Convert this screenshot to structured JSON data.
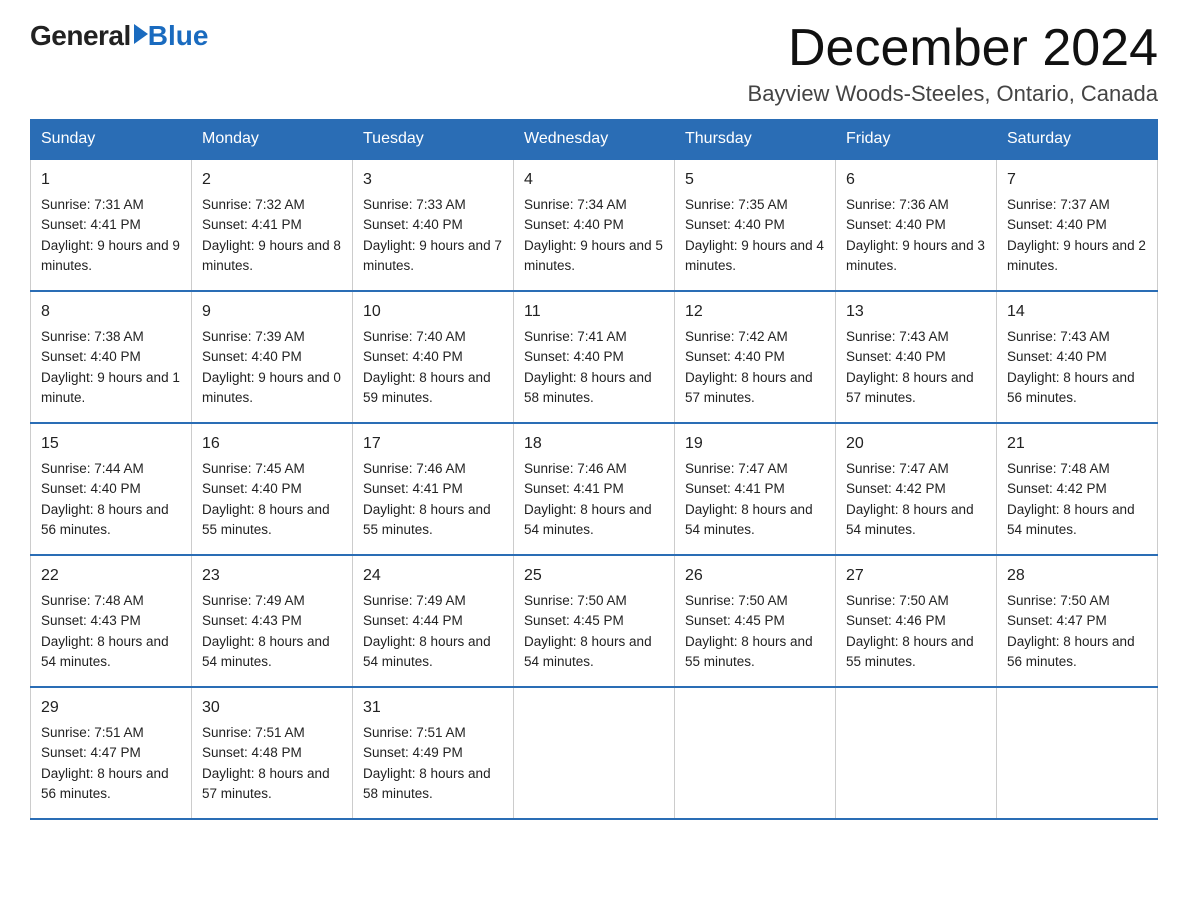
{
  "logo": {
    "general": "General",
    "blue": "Blue"
  },
  "header": {
    "month_year": "December 2024",
    "location": "Bayview Woods-Steeles, Ontario, Canada"
  },
  "days_of_week": [
    "Sunday",
    "Monday",
    "Tuesday",
    "Wednesday",
    "Thursday",
    "Friday",
    "Saturday"
  ],
  "weeks": [
    [
      {
        "day": "1",
        "sunrise": "7:31 AM",
        "sunset": "4:41 PM",
        "daylight": "9 hours and 9 minutes."
      },
      {
        "day": "2",
        "sunrise": "7:32 AM",
        "sunset": "4:41 PM",
        "daylight": "9 hours and 8 minutes."
      },
      {
        "day": "3",
        "sunrise": "7:33 AM",
        "sunset": "4:40 PM",
        "daylight": "9 hours and 7 minutes."
      },
      {
        "day": "4",
        "sunrise": "7:34 AM",
        "sunset": "4:40 PM",
        "daylight": "9 hours and 5 minutes."
      },
      {
        "day": "5",
        "sunrise": "7:35 AM",
        "sunset": "4:40 PM",
        "daylight": "9 hours and 4 minutes."
      },
      {
        "day": "6",
        "sunrise": "7:36 AM",
        "sunset": "4:40 PM",
        "daylight": "9 hours and 3 minutes."
      },
      {
        "day": "7",
        "sunrise": "7:37 AM",
        "sunset": "4:40 PM",
        "daylight": "9 hours and 2 minutes."
      }
    ],
    [
      {
        "day": "8",
        "sunrise": "7:38 AM",
        "sunset": "4:40 PM",
        "daylight": "9 hours and 1 minute."
      },
      {
        "day": "9",
        "sunrise": "7:39 AM",
        "sunset": "4:40 PM",
        "daylight": "9 hours and 0 minutes."
      },
      {
        "day": "10",
        "sunrise": "7:40 AM",
        "sunset": "4:40 PM",
        "daylight": "8 hours and 59 minutes."
      },
      {
        "day": "11",
        "sunrise": "7:41 AM",
        "sunset": "4:40 PM",
        "daylight": "8 hours and 58 minutes."
      },
      {
        "day": "12",
        "sunrise": "7:42 AM",
        "sunset": "4:40 PM",
        "daylight": "8 hours and 57 minutes."
      },
      {
        "day": "13",
        "sunrise": "7:43 AM",
        "sunset": "4:40 PM",
        "daylight": "8 hours and 57 minutes."
      },
      {
        "day": "14",
        "sunrise": "7:43 AM",
        "sunset": "4:40 PM",
        "daylight": "8 hours and 56 minutes."
      }
    ],
    [
      {
        "day": "15",
        "sunrise": "7:44 AM",
        "sunset": "4:40 PM",
        "daylight": "8 hours and 56 minutes."
      },
      {
        "day": "16",
        "sunrise": "7:45 AM",
        "sunset": "4:40 PM",
        "daylight": "8 hours and 55 minutes."
      },
      {
        "day": "17",
        "sunrise": "7:46 AM",
        "sunset": "4:41 PM",
        "daylight": "8 hours and 55 minutes."
      },
      {
        "day": "18",
        "sunrise": "7:46 AM",
        "sunset": "4:41 PM",
        "daylight": "8 hours and 54 minutes."
      },
      {
        "day": "19",
        "sunrise": "7:47 AM",
        "sunset": "4:41 PM",
        "daylight": "8 hours and 54 minutes."
      },
      {
        "day": "20",
        "sunrise": "7:47 AM",
        "sunset": "4:42 PM",
        "daylight": "8 hours and 54 minutes."
      },
      {
        "day": "21",
        "sunrise": "7:48 AM",
        "sunset": "4:42 PM",
        "daylight": "8 hours and 54 minutes."
      }
    ],
    [
      {
        "day": "22",
        "sunrise": "7:48 AM",
        "sunset": "4:43 PM",
        "daylight": "8 hours and 54 minutes."
      },
      {
        "day": "23",
        "sunrise": "7:49 AM",
        "sunset": "4:43 PM",
        "daylight": "8 hours and 54 minutes."
      },
      {
        "day": "24",
        "sunrise": "7:49 AM",
        "sunset": "4:44 PM",
        "daylight": "8 hours and 54 minutes."
      },
      {
        "day": "25",
        "sunrise": "7:50 AM",
        "sunset": "4:45 PM",
        "daylight": "8 hours and 54 minutes."
      },
      {
        "day": "26",
        "sunrise": "7:50 AM",
        "sunset": "4:45 PM",
        "daylight": "8 hours and 55 minutes."
      },
      {
        "day": "27",
        "sunrise": "7:50 AM",
        "sunset": "4:46 PM",
        "daylight": "8 hours and 55 minutes."
      },
      {
        "day": "28",
        "sunrise": "7:50 AM",
        "sunset": "4:47 PM",
        "daylight": "8 hours and 56 minutes."
      }
    ],
    [
      {
        "day": "29",
        "sunrise": "7:51 AM",
        "sunset": "4:47 PM",
        "daylight": "8 hours and 56 minutes."
      },
      {
        "day": "30",
        "sunrise": "7:51 AM",
        "sunset": "4:48 PM",
        "daylight": "8 hours and 57 minutes."
      },
      {
        "day": "31",
        "sunrise": "7:51 AM",
        "sunset": "4:49 PM",
        "daylight": "8 hours and 58 minutes."
      },
      null,
      null,
      null,
      null
    ]
  ]
}
